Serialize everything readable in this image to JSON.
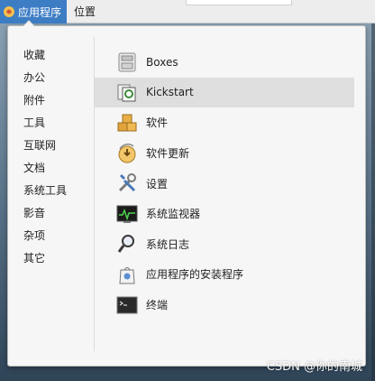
{
  "topbar": {
    "applications_label": "应用程序",
    "places_label": "位置"
  },
  "categories": [
    "收藏",
    "办公",
    "附件",
    "工具",
    "互联网",
    "文档",
    "系统工具",
    "影音",
    "杂项",
    "其它"
  ],
  "apps": [
    {
      "label": "Boxes",
      "icon": "boxes-icon"
    },
    {
      "label": "Kickstart",
      "icon": "kickstart-icon"
    },
    {
      "label": "软件",
      "icon": "software-icon"
    },
    {
      "label": "软件更新",
      "icon": "software-update-icon"
    },
    {
      "label": "设置",
      "icon": "settings-icon"
    },
    {
      "label": "系统监视器",
      "icon": "system-monitor-icon"
    },
    {
      "label": "系统日志",
      "icon": "system-log-icon"
    },
    {
      "label": "应用程序的安装程序",
      "icon": "app-installer-icon"
    },
    {
      "label": "终端",
      "icon": "terminal-icon"
    }
  ],
  "selected_app": "Kickstart",
  "watermark": "CSDN @你的南城",
  "colors": {
    "topbar_active": "#3d7dc4",
    "popup_bg": "#f6f6f6",
    "selected_row": "#dedede"
  }
}
